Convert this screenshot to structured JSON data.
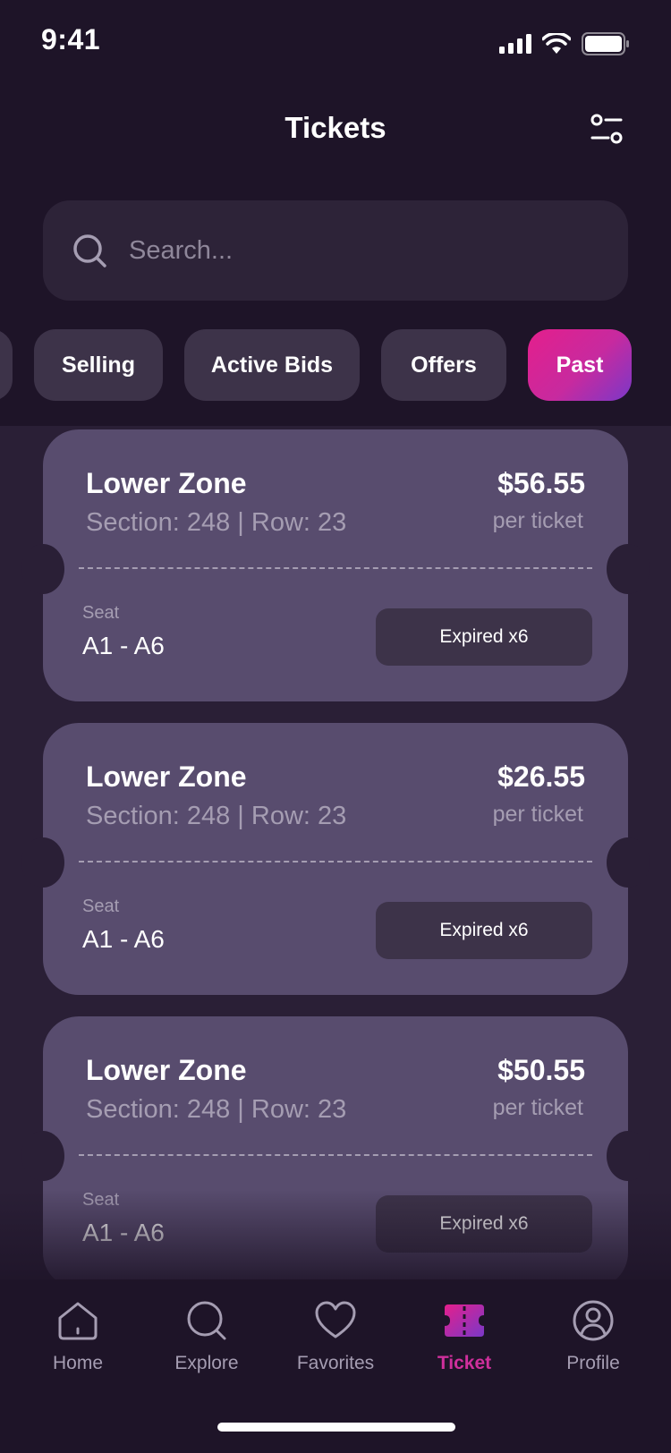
{
  "status_bar": {
    "time": "9:41"
  },
  "header": {
    "title": "Tickets"
  },
  "search": {
    "placeholder": "Search..."
  },
  "tabs": [
    {
      "label": ""
    },
    {
      "label": "Selling"
    },
    {
      "label": "Active Bids"
    },
    {
      "label": "Offers"
    },
    {
      "label": "Past"
    }
  ],
  "active_tab": "Past",
  "tickets": [
    {
      "zone": "Lower Zone",
      "location": "Section: 248 | Row: 23",
      "price": "$56.55",
      "per_ticket": "per ticket",
      "seat_label": "Seat",
      "seat_value": "A1 - A6",
      "status": "Expired x6"
    },
    {
      "zone": "Lower Zone",
      "location": "Section: 248 | Row: 23",
      "price": "$26.55",
      "per_ticket": "per ticket",
      "seat_label": "Seat",
      "seat_value": "A1 - A6",
      "status": "Expired x6"
    },
    {
      "zone": "Lower Zone",
      "location": "Section: 248 | Row: 23",
      "price": "$50.55",
      "per_ticket": "per ticket",
      "seat_label": "Seat",
      "seat_value": "A1 - A6",
      "status": "Expired x6"
    }
  ],
  "nav": [
    {
      "label": "Home",
      "icon": "home-icon"
    },
    {
      "label": "Explore",
      "icon": "search-icon"
    },
    {
      "label": "Favorites",
      "icon": "heart-icon"
    },
    {
      "label": "Ticket",
      "icon": "ticket-icon"
    },
    {
      "label": "Profile",
      "icon": "user-icon"
    }
  ],
  "active_nav": "Ticket",
  "colors": {
    "background": "#1e1428",
    "card": "#584c6e",
    "accent_start": "#e41f8c",
    "accent_end": "#7a38c8",
    "muted_text": "#a59db2"
  }
}
